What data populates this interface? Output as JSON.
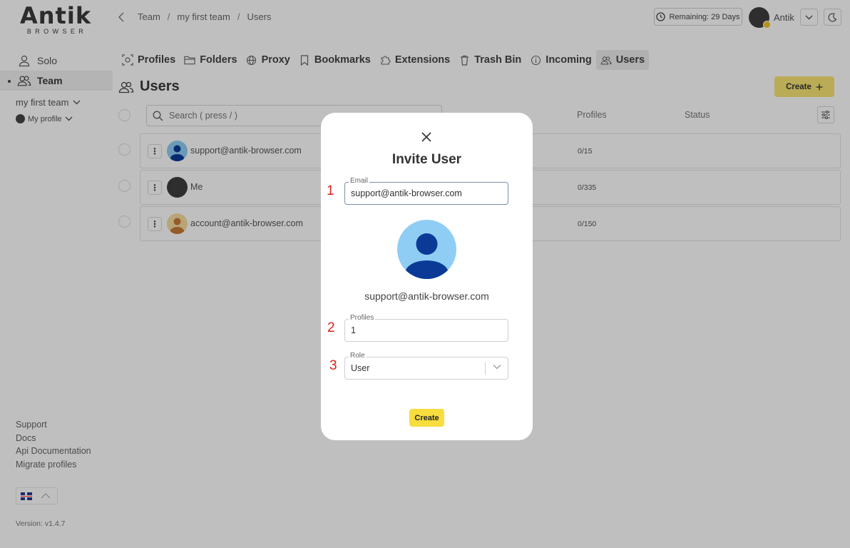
{
  "brand": {
    "logo_main": "Antik",
    "logo_sub": "BROWSER"
  },
  "sidebar": {
    "items": [
      {
        "label": "Solo"
      },
      {
        "label": "Team"
      }
    ],
    "team_select": "my first team",
    "profile_select": "My profile",
    "links": [
      "Support",
      "Docs",
      "Api Documentation",
      "Migrate profiles"
    ],
    "version": "Version: v1.4.7"
  },
  "header": {
    "breadcrumb": [
      "Team",
      "my first team",
      "Users"
    ],
    "remaining": "Remaining: 29 Days",
    "user_name": "Antik"
  },
  "tabs": [
    {
      "label": "Profiles",
      "icon": "profiles-icon"
    },
    {
      "label": "Folders",
      "icon": "folder-icon"
    },
    {
      "label": "Proxy",
      "icon": "globe-icon"
    },
    {
      "label": "Bookmarks",
      "icon": "bookmark-icon"
    },
    {
      "label": "Extensions",
      "icon": "puzzle-icon"
    },
    {
      "label": "Trash Bin",
      "icon": "trash-icon"
    },
    {
      "label": "Incoming",
      "icon": "info-icon"
    },
    {
      "label": "Users",
      "icon": "users-icon",
      "active": true
    }
  ],
  "page": {
    "title": "Users",
    "create_label": "Create",
    "search_placeholder": "Search ( press / )",
    "columns": {
      "profiles": "Profiles",
      "status": "Status"
    }
  },
  "users": [
    {
      "name": "support@antik-browser.com",
      "profiles": "0/15",
      "avatar": "blue"
    },
    {
      "name": "Me",
      "profiles": "0/335",
      "avatar": "dark"
    },
    {
      "name": "account@antik-browser.com",
      "profiles": "0/150",
      "avatar": "tan"
    }
  ],
  "modal": {
    "title": "Invite User",
    "email_label": "Email",
    "email_value": "support@antik-browser.com",
    "preview_email": "support@antik-browser.com",
    "profiles_label": "Profiles",
    "profiles_value": "1",
    "role_label": "Role",
    "role_value": "User",
    "create_label": "Create",
    "step_numbers": [
      "1",
      "2",
      "3"
    ]
  },
  "colors": {
    "accent_yellow": "#f8dd3f",
    "step_red": "#d9201f",
    "avatar_blue_bg": "#8fcdf5",
    "avatar_blue_fg": "#0a3a96"
  }
}
